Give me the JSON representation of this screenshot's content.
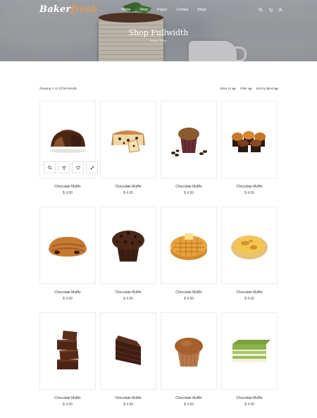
{
  "nav": {
    "logo_main": "Baker",
    "logo_accent": "fresh",
    "menu": [
      "Home",
      "Shop",
      "Pages",
      "Contact",
      "Blogs"
    ],
    "icons": [
      "search-icon",
      "cart-icon",
      "user-icon"
    ]
  },
  "hero": {
    "title": "Shop Fullwidth",
    "breadcrumb": "Home / Shop"
  },
  "toolbar": {
    "results": "Showing 1–12 Of 56 Results",
    "show": "Show 12",
    "filter": "Filter",
    "sort": "Sort by latest"
  },
  "product_actions": [
    "search-icon",
    "compare-icon",
    "heart-icon",
    "expand-icon"
  ],
  "products": [
    {
      "name": "Chocolate Muffin",
      "price": "$ 4.99",
      "image": "chocolate-bundt-cake"
    },
    {
      "name": "Chocolate Muffin",
      "price": "$ 4.99",
      "image": "sliced-pound-cake"
    },
    {
      "name": "Chocolate Muffin",
      "price": "$ 4.99",
      "image": "muffin-with-coffee-beans"
    },
    {
      "name": "Chocolate Muffin",
      "price": "$ 4.99",
      "image": "mini-muffins"
    },
    {
      "name": "Chocolate Muffin",
      "price": "$ 4.99",
      "image": "pain-au-chocolat"
    },
    {
      "name": "Chocolate Muffin",
      "price": "$ 4.99",
      "image": "chocolate-chip-muffin"
    },
    {
      "name": "Chocolate Muffin",
      "price": "$ 4.99",
      "image": "waffle-with-butter"
    },
    {
      "name": "Chocolate Muffin",
      "price": "$ 4.99",
      "image": "egg-tart"
    },
    {
      "name": "Chocolate Muffin",
      "price": "$ 4.99",
      "image": "brownie-stack"
    },
    {
      "name": "Chocolate Muffin",
      "price": "$ 4.99",
      "image": "chocolate-cake-slice"
    },
    {
      "name": "Chocolate Muffin",
      "price": "$ 4.99",
      "image": "plain-muffin"
    },
    {
      "name": "Chocolate Muffin",
      "price": "$ 4.99",
      "image": "matcha-cake"
    }
  ],
  "colors": {
    "logo_accent": "#e39a58",
    "text": "#333333",
    "border": "#ececec"
  }
}
